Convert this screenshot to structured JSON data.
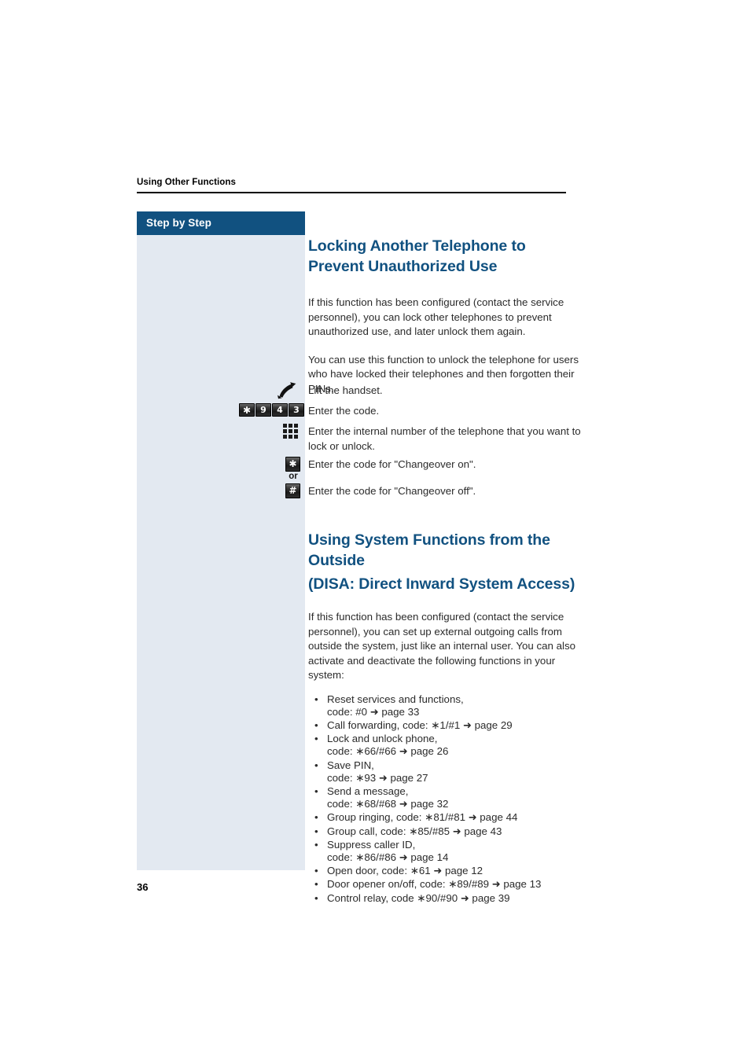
{
  "page": {
    "running_header": "Using Other Functions",
    "folio": "36",
    "sidebar_banner": "Step by Step",
    "colors": {
      "accent_blue": "#115180",
      "sidebar_tint": "#e3e9f1",
      "body_text": "#2b2b2b",
      "keycap_dark": "#1a1a1a"
    }
  },
  "section1": {
    "title": "Locking Another Telephone to Prevent Unauthorized Use",
    "paragraphs": [
      "If this function has been configured (contact the service personnel), you can lock other telephones to prevent unauthorized use, and later unlock them again.",
      "You can use this function to unlock the telephone for users who have locked their telephones and then forgotten their PINs."
    ],
    "steps": [
      {
        "icon": "lifted-handset-icon",
        "keys": [],
        "text": "Lift the handset."
      },
      {
        "icon": "keycap-sequence",
        "keys": [
          "✱",
          "9",
          "4",
          "3"
        ],
        "text": "Enter the code."
      },
      {
        "icon": "keypad-dots-icon",
        "keys": [],
        "text": "Enter the internal number of the telephone that you want to lock or unlock."
      },
      {
        "icon": "keycap-star",
        "keys": [
          "✱"
        ],
        "text": "Enter the code for \"Changeover on\"."
      },
      {
        "icon": "keycap-hash",
        "keys": [
          "#"
        ],
        "text": "Enter the code for \"Changeover off\"."
      }
    ],
    "or_label": "or"
  },
  "section2": {
    "title_line1": "Using System Functions from the",
    "title_line2": "Outside",
    "title_line3": "(DISA: Direct Inward System Access)",
    "paragraph": "If this function has been configured (contact the service personnel), you can set up external outgoing calls from outside the system, just like an internal user.  You can also activate and deactivate the following functions in your system:",
    "bullet_marker": "•",
    "arrow_glyph": "➜",
    "items": [
      {
        "line1": "Reset services and functions,",
        "line2_prefix": "code: #0 ",
        "line2_suffix": " page 33"
      },
      {
        "line1": "Call forwarding, code: ∗1/#1 ",
        "line1_suffix": " page 29",
        "line2_prefix": "",
        "line2_suffix": ""
      },
      {
        "line1": "Lock and unlock phone,",
        "line2_prefix": "code: ∗66/#66 ",
        "line2_suffix": " page 26"
      },
      {
        "line1": "Save PIN,",
        "line2_prefix": "code: ∗93 ",
        "line2_suffix": " page 27"
      },
      {
        "line1": "Send a message,",
        "line2_prefix": "code: ∗68/#68 ",
        "line2_suffix": " page 32"
      },
      {
        "line1": "Group ringing, code: ∗81/#81 ",
        "line1_suffix": " page 44",
        "line2_prefix": "",
        "line2_suffix": ""
      },
      {
        "line1": "Group call, code: ∗85/#85 ",
        "line1_suffix": " page 43",
        "line2_prefix": "",
        "line2_suffix": ""
      },
      {
        "line1": "Suppress caller ID,",
        "line2_prefix": "code: ∗86/#86 ",
        "line2_suffix": " page 14"
      },
      {
        "line1": "Open door, code: ∗61 ",
        "line1_suffix": " page 12",
        "line2_prefix": "",
        "line2_suffix": ""
      },
      {
        "line1": "Door opener on/off, code: ∗89/#89 ",
        "line1_suffix": " page 13",
        "line2_prefix": "",
        "line2_suffix": ""
      },
      {
        "line1": "Control relay, code ∗90/#90 ",
        "line1_suffix": " page 39",
        "line2_prefix": "",
        "line2_suffix": ""
      }
    ]
  }
}
